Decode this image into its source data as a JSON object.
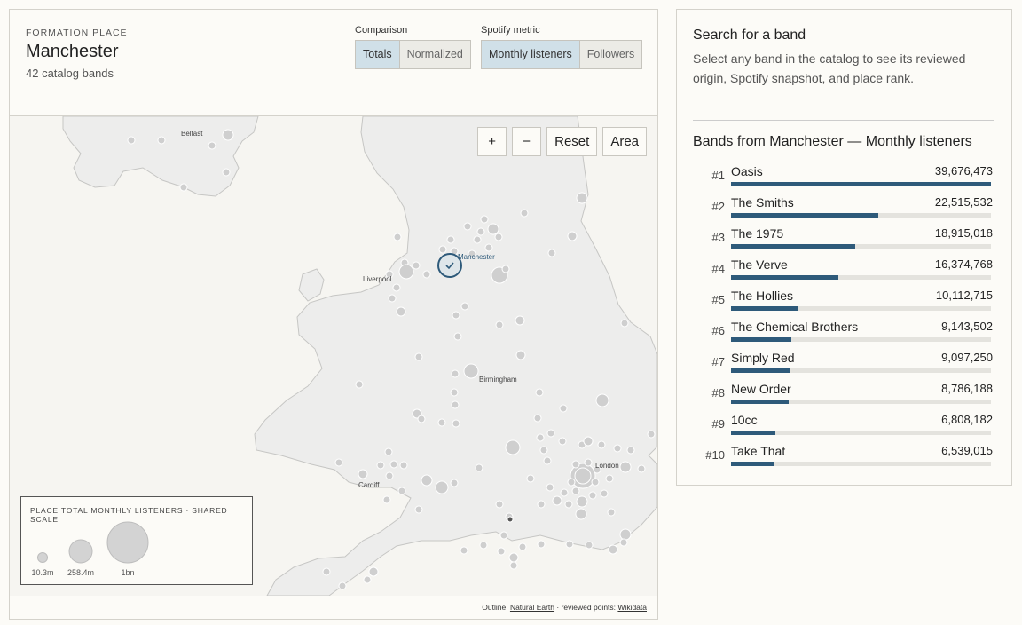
{
  "header": {
    "eyebrow": "FORMATION PLACE",
    "place": "Manchester",
    "band_count": "42 catalog bands"
  },
  "comparison": {
    "label": "Comparison",
    "options": [
      "Totals",
      "Normalized"
    ],
    "selected": "Totals"
  },
  "metric": {
    "label": "Spotify metric",
    "options": [
      "Monthly listeners",
      "Followers"
    ],
    "selected": "Monthly listeners"
  },
  "map": {
    "controls": {
      "zoom_in": "+",
      "zoom_out": "−",
      "reset": "Reset",
      "area": "Area"
    },
    "labels": [
      "Belfast",
      "Manchester",
      "Liverpool",
      "Birmingham",
      "Cardiff",
      "London"
    ],
    "selected_marker": "Manchester",
    "land_color": "#ededec",
    "sea_color": "#f6f5f1",
    "point_color": "#cfcfcf",
    "selected_color": "#2e5a7a"
  },
  "legend": {
    "title": "PLACE TOTAL MONTHLY LISTENERS · SHARED SCALE",
    "items": [
      "10.3m",
      "258.4m",
      "1bn"
    ]
  },
  "attribution": {
    "prefix": "Outline:",
    "outline_link": "Natural Earth",
    "middle": "· reviewed points:",
    "points_link": "Wikidata"
  },
  "sidebar": {
    "search_heading": "Search for a band",
    "search_desc": "Select any band in the catalog to see its reviewed origin, Spotify snapshot, and place rank.",
    "list_heading": "Bands from Manchester — Monthly listeners",
    "bar_color": "#2e5a7a",
    "bands": [
      {
        "rank": "#1",
        "name": "Oasis",
        "value": "39,676,473",
        "listeners": 39676473
      },
      {
        "rank": "#2",
        "name": "The Smiths",
        "value": "22,515,532",
        "listeners": 22515532
      },
      {
        "rank": "#3",
        "name": "The 1975",
        "value": "18,915,018",
        "listeners": 18915018
      },
      {
        "rank": "#4",
        "name": "The Verve",
        "value": "16,374,768",
        "listeners": 16374768
      },
      {
        "rank": "#5",
        "name": "The Hollies",
        "value": "10,112,715",
        "listeners": 10112715
      },
      {
        "rank": "#6",
        "name": "The Chemical Brothers",
        "value": "9,143,502",
        "listeners": 9143502
      },
      {
        "rank": "#7",
        "name": "Simply Red",
        "value": "9,097,250",
        "listeners": 9097250
      },
      {
        "rank": "#8",
        "name": "New Order",
        "value": "8,786,188",
        "listeners": 8786188
      },
      {
        "rank": "#9",
        "name": "10cc",
        "value": "6,808,182",
        "listeners": 6808182
      },
      {
        "rank": "#10",
        "name": "Take That",
        "value": "6,539,015",
        "listeners": 6539015
      }
    ]
  }
}
